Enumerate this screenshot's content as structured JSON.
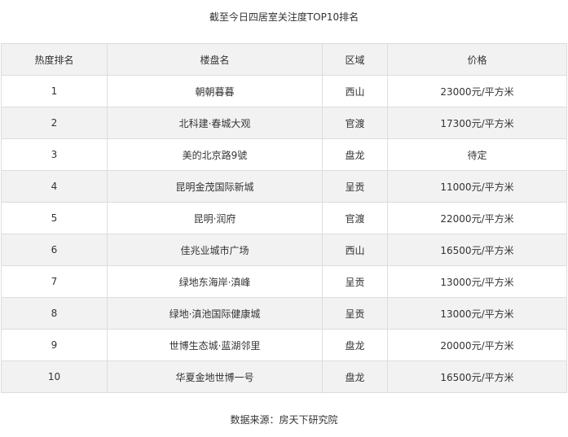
{
  "title": "截至今日四居室关注度TOP10排名",
  "table": {
    "headers": [
      "热度排名",
      "楼盘名",
      "区域",
      "价格"
    ],
    "rows": [
      {
        "rank": "1",
        "name": "朝朝暮暮",
        "area": "西山",
        "price": "23000元/平方米"
      },
      {
        "rank": "2",
        "name": "北科建·春城大观",
        "area": "官渡",
        "price": "17300元/平方米"
      },
      {
        "rank": "3",
        "name": "美的北京路9號",
        "area": "盘龙",
        "price": "待定"
      },
      {
        "rank": "4",
        "name": "昆明金茂国际新城",
        "area": "呈贡",
        "price": "11000元/平方米"
      },
      {
        "rank": "5",
        "name": "昆明·润府",
        "area": "官渡",
        "price": "22000元/平方米"
      },
      {
        "rank": "6",
        "name": "佳兆业城市广场",
        "area": "西山",
        "price": "16500元/平方米"
      },
      {
        "rank": "7",
        "name": "绿地东海岸·滇峰",
        "area": "呈贡",
        "price": "13000元/平方米"
      },
      {
        "rank": "8",
        "name": "绿地·滇池国际健康城",
        "area": "呈贡",
        "price": "13000元/平方米"
      },
      {
        "rank": "9",
        "name": "世博生态城·蓝湖邻里",
        "area": "盘龙",
        "price": "20000元/平方米"
      },
      {
        "rank": "10",
        "name": "华夏金地世博一号",
        "area": "盘龙",
        "price": "16500元/平方米"
      }
    ]
  },
  "source": "数据来源：房天下研究院"
}
